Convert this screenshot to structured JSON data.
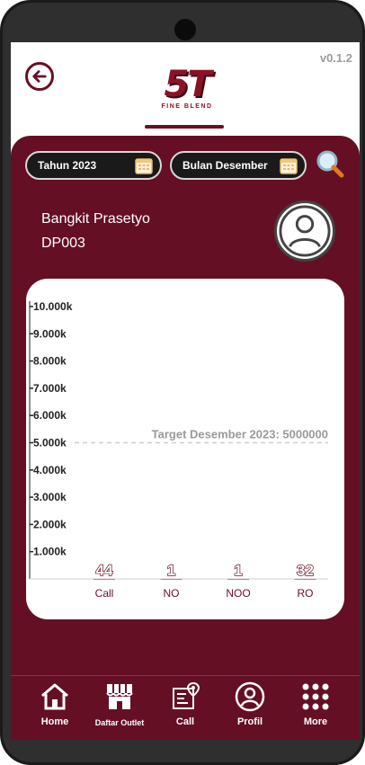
{
  "app": {
    "version": "v0.1.2",
    "logo_text": "5T",
    "logo_subtitle": "FINE BLEND",
    "brand_color": "#650f24"
  },
  "filters": {
    "year_label": "Tahun 2023",
    "month_label": "Bulan Desember"
  },
  "user": {
    "name": "Bangkit Prasetyo",
    "code": "DP003"
  },
  "chart_data": {
    "type": "bar",
    "categories": [
      "Call",
      "NO",
      "NOO",
      "RO"
    ],
    "values": [
      44,
      1,
      1,
      32
    ],
    "value_labels": [
      "44",
      "1",
      "1",
      "32"
    ],
    "y_ticks": [
      "1.000k",
      "2.000k",
      "3.000k",
      "4.000k",
      "5.000k",
      "6.000k",
      "7.000k",
      "8.000k",
      "9.000k",
      "10.000k"
    ],
    "ylim": [
      0,
      10000000
    ],
    "target_value": 5000000,
    "target_label": "Target Desember 2023: 5000000",
    "grid": false
  },
  "nav": {
    "items": [
      {
        "label": "Home",
        "icon": "home-icon"
      },
      {
        "label": "Daftar Outlet",
        "icon": "store-icon"
      },
      {
        "label": "Call",
        "icon": "call-map-icon"
      },
      {
        "label": "Profil",
        "icon": "profile-icon"
      },
      {
        "label": "More",
        "icon": "grid-dots-icon"
      }
    ]
  }
}
